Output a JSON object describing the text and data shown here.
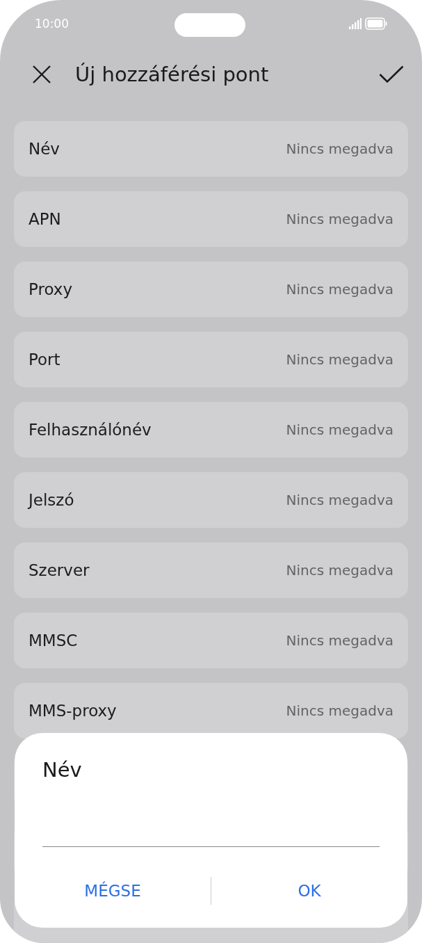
{
  "status_bar": {
    "time": "10:00"
  },
  "header": {
    "title": "Új hozzáférési pont"
  },
  "rows": [
    {
      "label": "Név",
      "value": "Nincs megadva"
    },
    {
      "label": "APN",
      "value": "Nincs megadva"
    },
    {
      "label": "Proxy",
      "value": "Nincs megadva"
    },
    {
      "label": "Port",
      "value": "Nincs megadva"
    },
    {
      "label": "Felhasználónév",
      "value": "Nincs megadva"
    },
    {
      "label": "Jelszó",
      "value": "Nincs megadva"
    },
    {
      "label": "Szerver",
      "value": "Nincs megadva"
    },
    {
      "label": "MMSC",
      "value": "Nincs megadva"
    },
    {
      "label": "MMS-proxy",
      "value": "Nincs megadva"
    }
  ],
  "dialog": {
    "title": "Név",
    "buttons": [
      "MÉGSE",
      "OK"
    ]
  }
}
